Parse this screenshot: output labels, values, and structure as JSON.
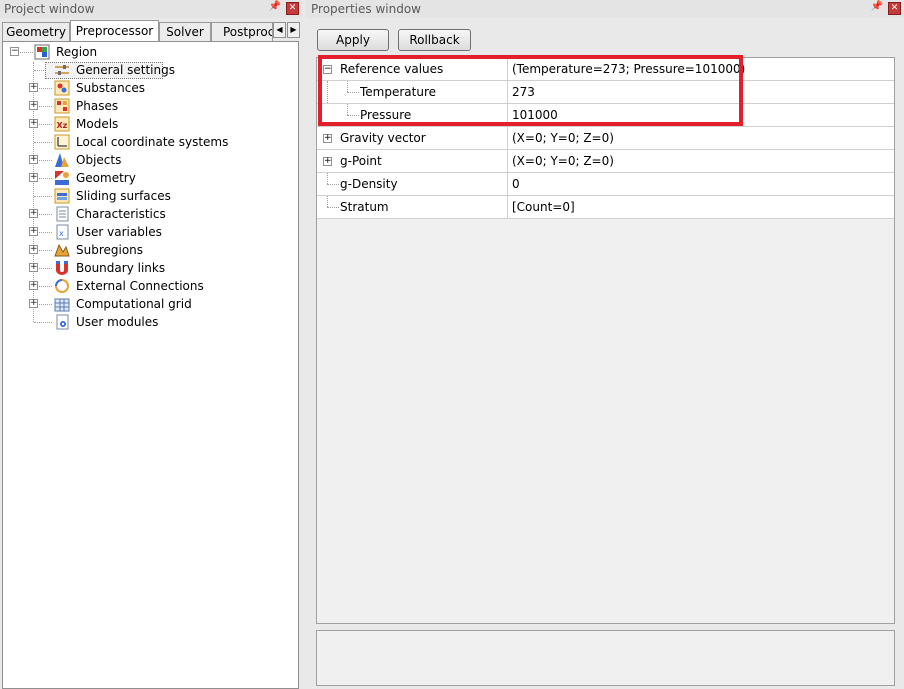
{
  "project_window": {
    "title": "Project window",
    "tabs": [
      {
        "label": "Geometry"
      },
      {
        "label": "Preprocessor",
        "active": true
      },
      {
        "label": "Solver"
      },
      {
        "label": "Postproce"
      }
    ],
    "tree": {
      "root": "Region",
      "items": [
        {
          "label": "General settings",
          "icon": "settings-sliders-icon",
          "expandable": false,
          "selected": true
        },
        {
          "label": "Substances",
          "icon": "substances-icon",
          "expandable": true
        },
        {
          "label": "Phases",
          "icon": "phases-icon",
          "expandable": true
        },
        {
          "label": "Models",
          "icon": "models-icon",
          "expandable": true
        },
        {
          "label": "Local coordinate systems",
          "icon": "coordinate-system-icon",
          "expandable": false
        },
        {
          "label": "Objects",
          "icon": "objects-icon",
          "expandable": true
        },
        {
          "label": "Geometry",
          "icon": "geometry-icon",
          "expandable": true
        },
        {
          "label": "Sliding surfaces",
          "icon": "sliding-surfaces-icon",
          "expandable": false
        },
        {
          "label": "Characteristics",
          "icon": "characteristics-icon",
          "expandable": true
        },
        {
          "label": "User variables",
          "icon": "user-variables-icon",
          "expandable": true
        },
        {
          "label": "Subregions",
          "icon": "subregions-icon",
          "expandable": true
        },
        {
          "label": "Boundary links",
          "icon": "boundary-links-icon",
          "expandable": true
        },
        {
          "label": "External Connections",
          "icon": "external-connections-icon",
          "expandable": true
        },
        {
          "label": "Computational grid",
          "icon": "computational-grid-icon",
          "expandable": true
        },
        {
          "label": "User modules",
          "icon": "user-modules-icon",
          "expandable": false
        }
      ]
    }
  },
  "properties_window": {
    "title": "Properties window",
    "apply_label": "Apply",
    "rollback_label": "Rollback",
    "rows": [
      {
        "name": "Reference values",
        "value": "(Temperature=273; Pressure=101000)",
        "expander": "minus",
        "level": 0
      },
      {
        "name": "Temperature",
        "value": "273",
        "expander": "none",
        "level": 1
      },
      {
        "name": "Pressure",
        "value": "101000",
        "expander": "none",
        "level": 1
      },
      {
        "name": "Gravity vector",
        "value": "(X=0; Y=0; Z=0)",
        "expander": "plus",
        "level": 0
      },
      {
        "name": "g-Point",
        "value": "(X=0; Y=0; Z=0)",
        "expander": "plus",
        "level": 0
      },
      {
        "name": "g-Density",
        "value": "0",
        "expander": "none",
        "level": 0
      },
      {
        "name": "Stratum",
        "value": "[Count=0]",
        "expander": "none",
        "level": 0
      }
    ]
  },
  "colors": {
    "highlight": "#e21f2a",
    "window_bg": "#e9e9e9",
    "grid_line": "#d0d0d0"
  }
}
